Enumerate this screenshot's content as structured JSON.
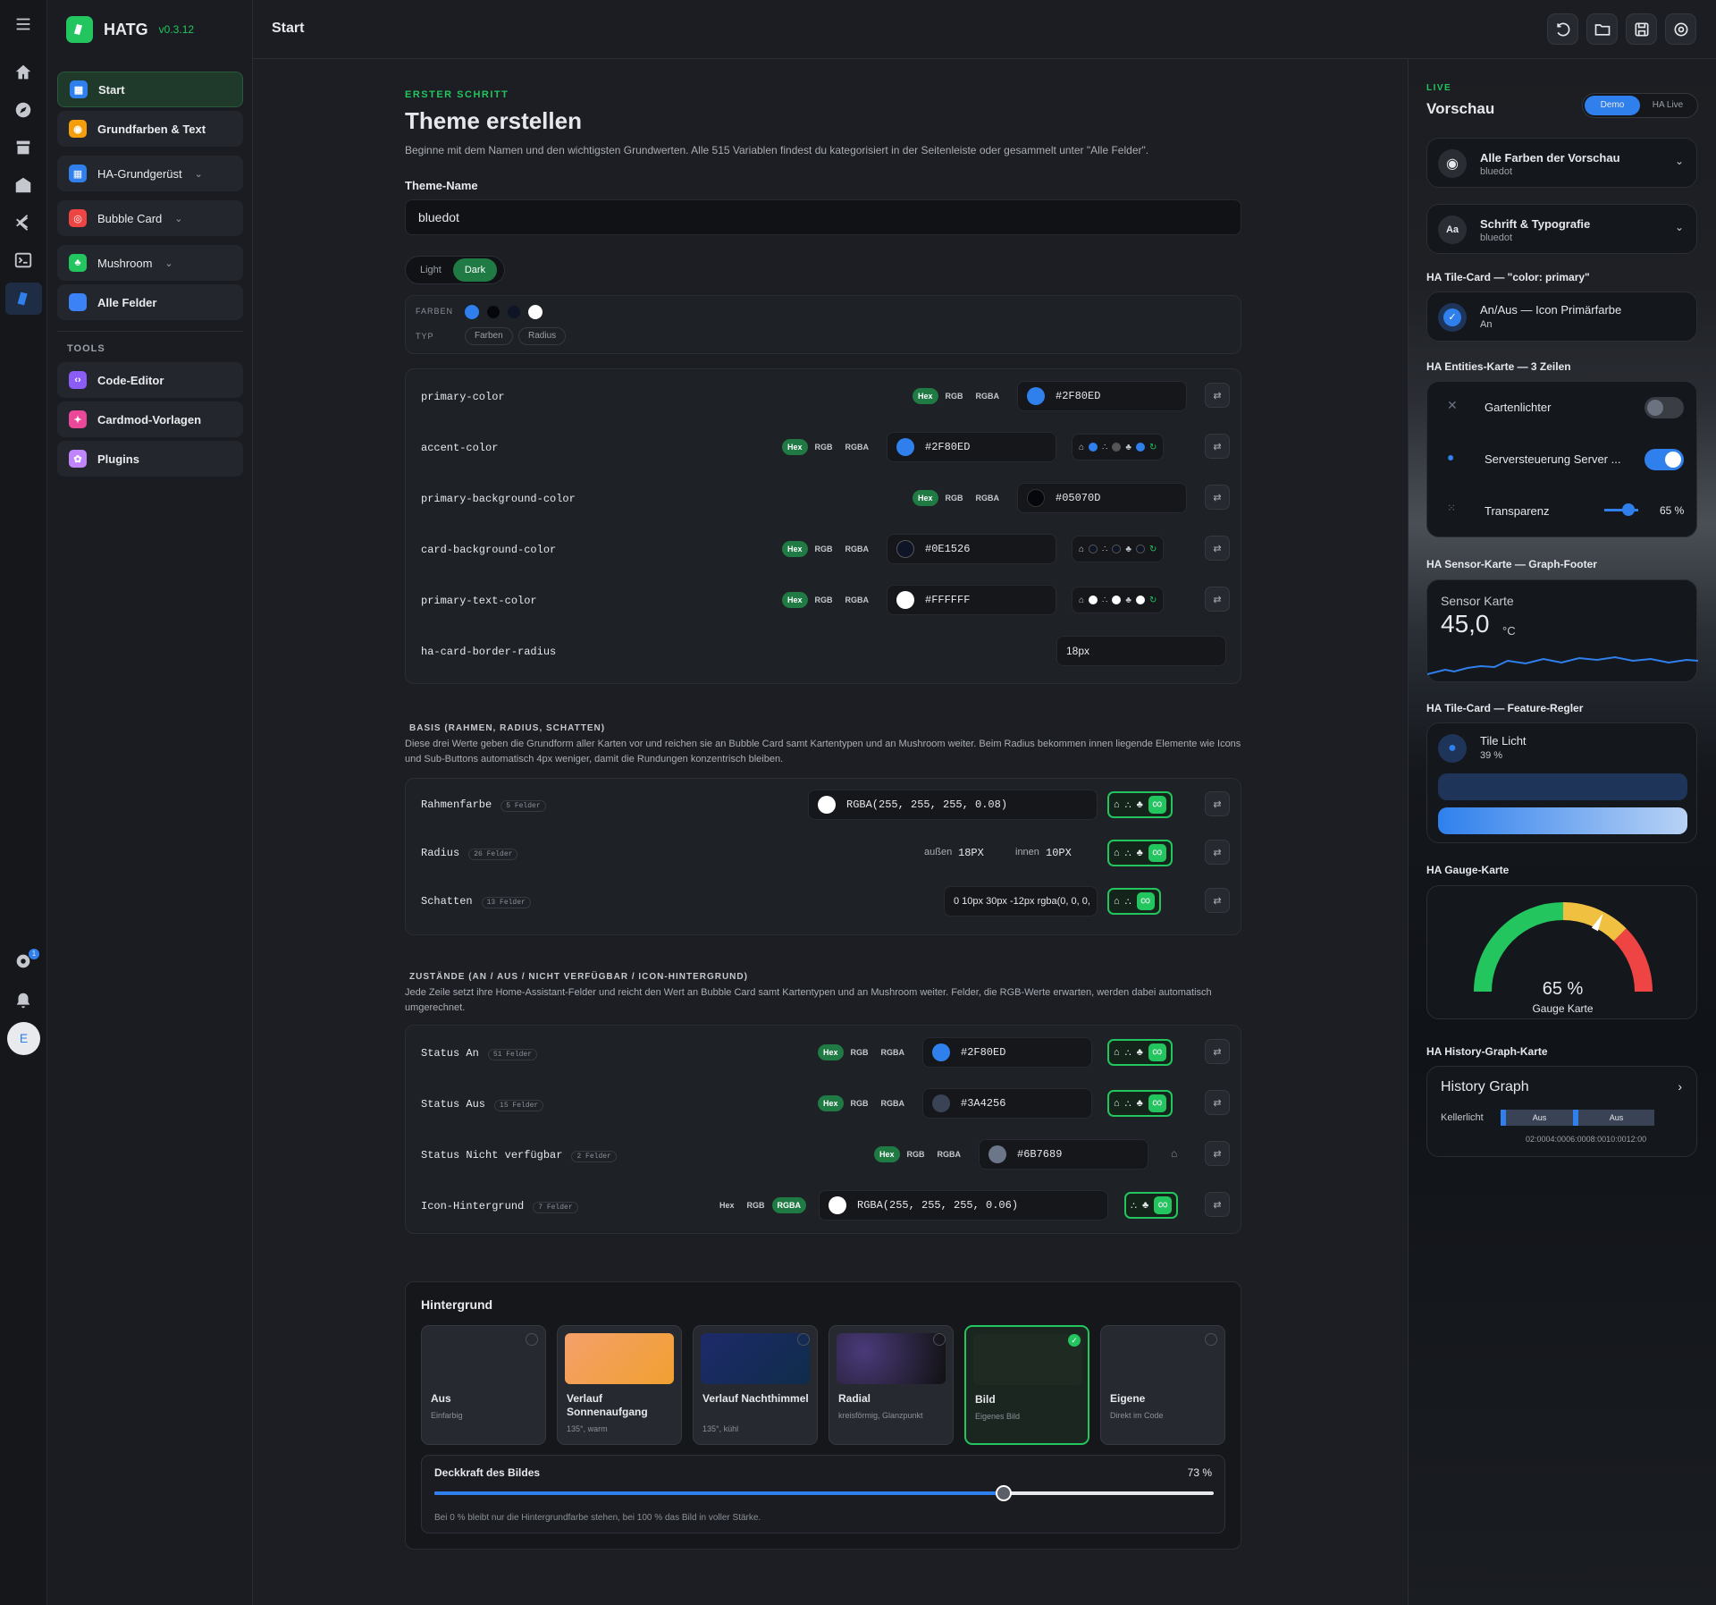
{
  "app": {
    "name": "HATG",
    "version": "v0.3.12"
  },
  "sidebar": {
    "items": [
      {
        "label": "Start"
      },
      {
        "label": "Grundfarben & Text"
      },
      {
        "label": "HA-Grundgerüst"
      },
      {
        "label": "Bubble Card"
      },
      {
        "label": "Mushroom"
      },
      {
        "label": "Alle Felder"
      }
    ],
    "tools_heading": "TOOLS",
    "tools": [
      {
        "label": "Code-Editor"
      },
      {
        "label": "Cardmod-Vorlagen"
      },
      {
        "label": "Plugins"
      }
    ]
  },
  "rail": {
    "avatar": "E",
    "badge": "1"
  },
  "topbar": {
    "title": "Start"
  },
  "main": {
    "eyebrow": "ERSTER SCHRITT",
    "title": "Theme erstellen",
    "lead": "Beginne mit dem Namen und den wichtigsten Grundwerten. Alle 515 Variablen findest du kategorisiert in der Seitenleiste oder gesammelt unter \"Alle Felder\".",
    "theme_name_label": "Theme-Name",
    "theme_name_value": "bluedot",
    "mode": {
      "light": "Light",
      "dark": "Dark"
    },
    "filter": {
      "farben_label": "FARBEN",
      "typ_label": "TYP",
      "typ_options": [
        "Farben",
        "Radius"
      ]
    }
  },
  "format": {
    "hex": "Hex",
    "rgb": "RGB",
    "rgba": "RGBA"
  },
  "vars": [
    {
      "key": "primary-color",
      "value": "#2F80ED",
      "swatch": "#2F80ED"
    },
    {
      "key": "accent-color",
      "value": "#2F80ED",
      "swatch": "#2F80ED"
    },
    {
      "key": "primary-background-color",
      "value": "#05070D",
      "swatch": "#05070D"
    },
    {
      "key": "card-background-color",
      "value": "#0E1526",
      "swatch": "#0E1526"
    },
    {
      "key": "primary-text-color",
      "value": "#FFFFFF",
      "swatch": "#FFFFFF"
    },
    {
      "key": "ha-card-border-radius",
      "value": "18px"
    }
  ],
  "basis": {
    "heading": "BASIS (RAHMEN, RADIUS, SCHATTEN)",
    "text": "Diese drei Werte geben die Grundform aller Karten vor und reichen sie an Bubble Card samt Kartentypen und an Mushroom weiter. Beim Radius bekommen innen liegende Elemente wie Icons und Sub-Buttons automatisch 4px weniger, damit die Rundungen konzentrisch bleiben.",
    "rows": [
      {
        "key": "Rahmenfarbe",
        "count": "5 Felder",
        "value": "RGBA(255, 255, 255, 0.08)"
      },
      {
        "key": "Radius",
        "count": "26 Felder",
        "outer_label": "außen",
        "outer": "18PX",
        "inner_label": "innen",
        "inner": "10PX"
      },
      {
        "key": "Schatten",
        "count": "13 Felder",
        "value": "0 10px 30px -12px rgba(0, 0, 0,"
      }
    ]
  },
  "states": {
    "heading": "ZUSTÄNDE (AN / AUS / NICHT VERFÜGBAR / ICON-HINTERGRUND)",
    "text": "Jede Zeile setzt ihre Home-Assistant-Felder und reicht den Wert an Bubble Card samt Kartentypen und an Mushroom weiter. Felder, die RGB-Werte erwarten, werden dabei automatisch umgerechnet.",
    "rows": [
      {
        "key": "Status An",
        "count": "51 Felder",
        "value": "#2F80ED",
        "swatch": "#2F80ED"
      },
      {
        "key": "Status Aus",
        "count": "15 Felder",
        "value": "#3A4256",
        "swatch": "#3A4256"
      },
      {
        "key": "Status Nicht verfügbar",
        "count": "2 Felder",
        "value": "#6B7689",
        "swatch": "#6B7689"
      },
      {
        "key": "Icon-Hintergrund",
        "count": "7 Felder",
        "value": "RGBA(255, 255, 255, 0.06)",
        "swatch": "#FFFFFF"
      }
    ]
  },
  "background": {
    "heading": "Hintergrund",
    "options": [
      {
        "title": "Aus",
        "sub": "Einfarbig"
      },
      {
        "title": "Verlauf Sonnenaufgang",
        "sub": "135°, warm"
      },
      {
        "title": "Verlauf Nachthimmel",
        "sub": "135°, kühl"
      },
      {
        "title": "Radial",
        "sub": "kreisförmig, Glanzpunkt"
      },
      {
        "title": "Bild",
        "sub": "Eigenes Bild",
        "selected": true
      },
      {
        "title": "Eigene",
        "sub": "Direkt im Code"
      }
    ],
    "opacity_label": "Deckkraft des Bildes",
    "opacity_value": "73 %",
    "opacity": 0.73,
    "opacity_hint": "Bei 0 % bleibt nur die Hintergrundfarbe stehen, bei 100 % das Bild in voller Stärke."
  },
  "preview": {
    "live": "LIVE",
    "title": "Vorschau",
    "demo": "Demo",
    "ha_live": "HA Live",
    "c1": {
      "title": "Alle Farben der Vorschau",
      "sub": "bluedot"
    },
    "c2": {
      "title": "Schrift & Typografie",
      "sub": "bluedot"
    },
    "tile_h": "HA Tile-Card — \"color: primary\"",
    "tile_title": "An/Aus — Icon Primärfarbe",
    "tile_sub": "An",
    "ent_h": "HA Entities-Karte — 3 Zeilen",
    "ent_rows": [
      {
        "label": "Gartenlichter"
      },
      {
        "label": "Serversteuerung Server ..."
      },
      {
        "label": "Transparenz",
        "value": "65 %"
      }
    ],
    "sensor_h": "HA Sensor-Karte — Graph-Footer",
    "sensor_name": "Sensor Karte",
    "sensor_value": "45,0",
    "sensor_unit": "°C",
    "feat_h": "HA Tile-Card — Feature-Regler",
    "feat_title": "Tile Licht",
    "feat_sub": "39 %",
    "gauge_h": "HA Gauge-Karte",
    "gauge_value": "65 %",
    "gauge_name": "Gauge Karte",
    "gauge_level": 0.65,
    "hist_h": "HA History-Graph-Karte",
    "hist_title": "History Graph",
    "hist_entity": "Kellerlicht",
    "hist_seg": [
      "Aus",
      "Aus"
    ],
    "hist_times": [
      "02:00",
      "04:00",
      "06:00",
      "08:00",
      "10:00",
      "12:00"
    ]
  }
}
